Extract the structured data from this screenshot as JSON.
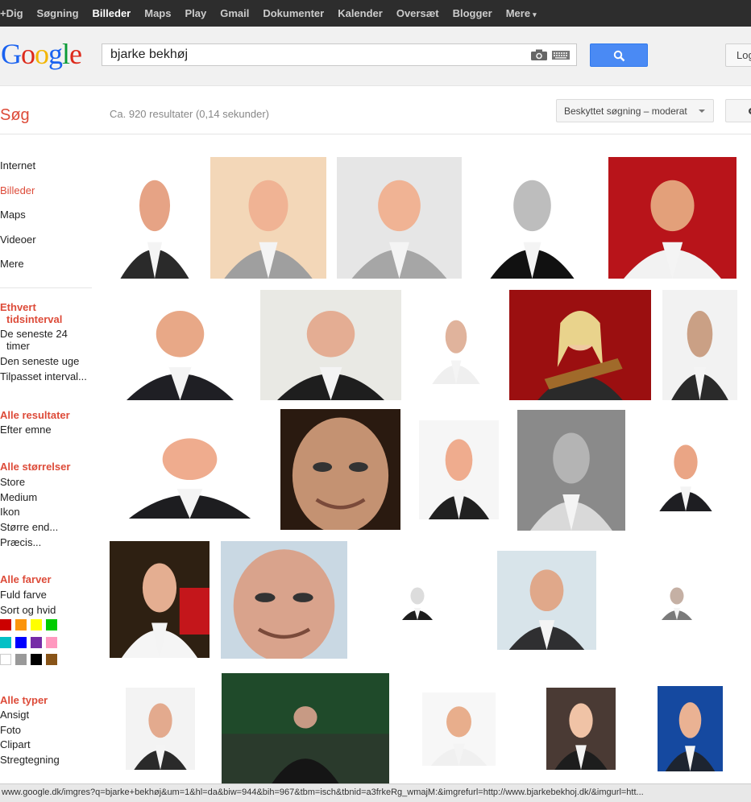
{
  "topnav": {
    "items": [
      "+Dig",
      "Søgning",
      "Billeder",
      "Maps",
      "Play",
      "Gmail",
      "Dokumenter",
      "Kalender",
      "Oversæt",
      "Blogger",
      "Mere"
    ],
    "active_index": 2,
    "more_suffix": "▾"
  },
  "header": {
    "logo": "Google",
    "search_value": "bjarke bekhøj",
    "login_label": "Log"
  },
  "subbar": {
    "sog_label": "Søg",
    "result_stats": "Ca. 920 resultater (0,14 sekunder)",
    "safesearch_label": "Beskyttet søgning – moderat"
  },
  "sidebar": {
    "types": [
      "Internet",
      "Billeder",
      "Maps",
      "Videoer",
      "Mere"
    ],
    "active_type_index": 1,
    "time_head_1": "Ethvert",
    "time_head_2": "tidsinterval",
    "time_items": [
      "De seneste 24",
      "timer",
      "Den seneste uge",
      "Tilpasset interval..."
    ],
    "results_head": "Alle resultater",
    "results_items": [
      "Efter emne"
    ],
    "size_head": "Alle størrelser",
    "size_items": [
      "Store",
      "Medium",
      "Ikon",
      "Større end...",
      "Præcis..."
    ],
    "color_head": "Alle farver",
    "color_items": [
      "Fuld farve",
      "Sort og hvid"
    ],
    "color_swatches": [
      "#cc0000",
      "#fb940b",
      "#ffff00",
      "#00cc00",
      "#03c0c6",
      "#0000ff",
      "#762ca7",
      "#ff98bf",
      "#ffffff",
      "#999999",
      "#000000",
      "#885418"
    ],
    "type_head": "Alle typer",
    "type_items": [
      "Ansigt",
      "Foto",
      "Clipart",
      "Stregtegning"
    ]
  },
  "statusbar": {
    "url": "www.google.dk/imgres?q=bjarke+bekhøj&um=1&hl=da&biw=944&bih=967&tbm=isch&tbnid=a3frkeRg_wmajM:&imgrefurl=http://www.bjarkebekhoj.dk/&imgurl=htt..."
  },
  "colors": {
    "accent_red": "#dd4b39",
    "search_blue": "#4a8af4",
    "topbar_bg": "#2d2d2d"
  },
  "icons": [
    "camera-icon",
    "keyboard-icon",
    "search-icon",
    "gear-icon",
    "chevron-down-icon"
  ]
}
